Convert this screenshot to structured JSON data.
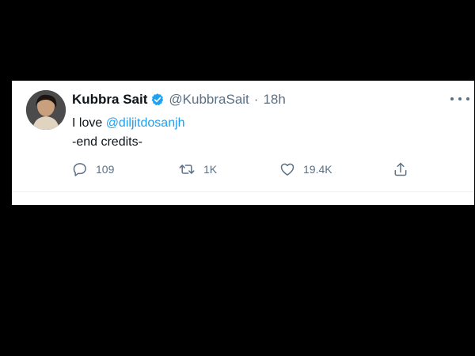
{
  "tweet": {
    "author_name": "Kubbra Sait",
    "handle": "@KubbraSait",
    "separator": "·",
    "time": "18h",
    "text_prefix": "I love ",
    "mention": "@diljitdosanjh",
    "line2": "-end credits-",
    "avatar_icon": "user-avatar",
    "verified_icon": "verified-badge-icon",
    "accent_color": "#1da1f2"
  },
  "actions": {
    "reply_count": "109",
    "retweet_count": "1K",
    "like_count": "19.4K"
  },
  "icons": {
    "reply": "reply-icon",
    "retweet": "retweet-icon",
    "like": "like-icon",
    "share": "share-icon",
    "more": "more-options-icon"
  }
}
